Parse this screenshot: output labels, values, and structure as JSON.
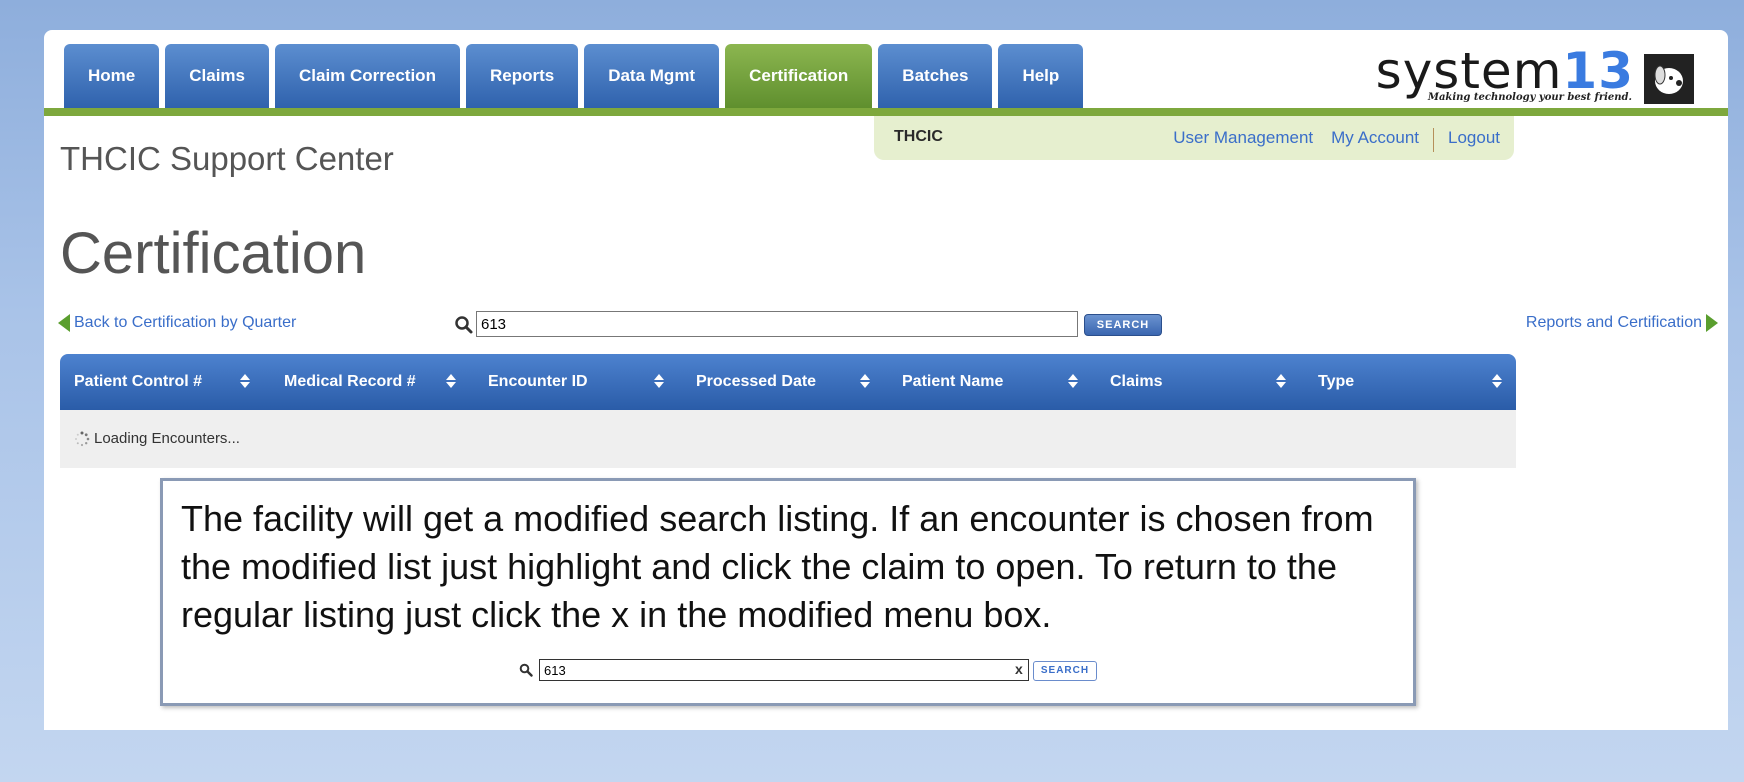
{
  "nav": {
    "tabs": [
      {
        "label": "Home"
      },
      {
        "label": "Claims"
      },
      {
        "label": "Claim Correction"
      },
      {
        "label": "Reports"
      },
      {
        "label": "Data Mgmt"
      },
      {
        "label": "Certification",
        "active": true
      },
      {
        "label": "Batches"
      },
      {
        "label": "Help"
      }
    ]
  },
  "logo": {
    "word": "system",
    "number": "13",
    "tagline": "Making technology your best friend."
  },
  "userbar": {
    "org": "THCIC",
    "user_management": "User Management",
    "my_account": "My Account",
    "logout": "Logout"
  },
  "site_title": "THCIC Support Center",
  "page_heading": "Certification",
  "controls": {
    "back_link": "Back to Certification by Quarter",
    "search_value": "613",
    "search_button": "SEARCH",
    "forward_link": "Reports and Certification"
  },
  "table": {
    "columns": [
      "Patient Control #",
      "Medical Record #",
      "Encounter ID",
      "Processed Date",
      "Patient Name",
      "Claims",
      "Type"
    ],
    "loading_text": "Loading Encounters..."
  },
  "callout": {
    "text": "The facility will get a modified search listing. If an encounter is chosen from the modified list just highlight and click the claim to open.  To return to the regular listing just click the x in the modified menu box.",
    "search_value": "613",
    "clear_symbol": "x",
    "search_button": "SEARCH"
  },
  "colors": {
    "tab_blue": "#2f62ad",
    "tab_active_green": "#5f8f2e",
    "link_blue": "#3a6ec9",
    "accent_green": "#7ea83d"
  }
}
